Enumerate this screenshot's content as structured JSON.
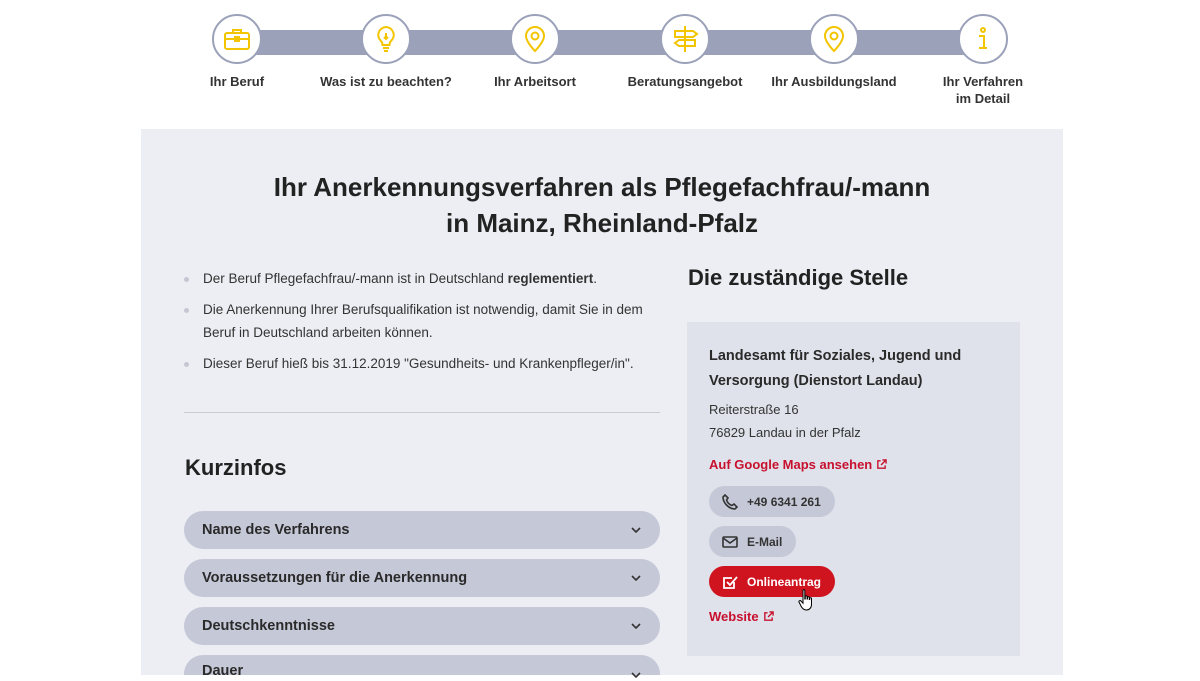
{
  "steps": [
    {
      "label": "Ihr Beruf",
      "icon": "briefcase-icon"
    },
    {
      "label": "Was ist zu beachten?",
      "icon": "lightbulb-icon"
    },
    {
      "label": "Ihr Arbeitsort",
      "icon": "location-pin-icon"
    },
    {
      "label": "Beratungsangebot",
      "icon": "signpost-icon"
    },
    {
      "label": "Ihr Ausbildungsland",
      "icon": "location-pin-icon"
    },
    {
      "label_line1": "Ihr Verfahren",
      "label_line2": "im Detail",
      "icon": "info-icon"
    }
  ],
  "page": {
    "title_line1": "Ihr Anerkennungsverfahren als Pflegefachfrau/-mann",
    "title_line2": "in Mainz, Rheinland-Pfalz"
  },
  "bullets": {
    "b1_pre": "Der Beruf Pflegefachfrau/-mann ist in Deutschland ",
    "b1_bold": "reglementiert",
    "b1_post": ".",
    "b2": "Die Anerkennung Ihrer Berufsqualifikation ist notwendig, damit Sie in dem Beruf in Deutschland arbeiten können.",
    "b3": "Dieser Beruf hieß bis 31.12.2019 \"Gesundheits- und Krankenpfleger/in\"."
  },
  "kurzinfos": {
    "title": "Kurzinfos",
    "items": [
      "Name des Verfahrens",
      "Voraussetzungen für die Anerkennung",
      "Deutschkenntnisse",
      "Dauer"
    ]
  },
  "stelle": {
    "title": "Die zuständige Stelle",
    "org": "Landesamt für Soziales, Jugend und Versorgung (Dienstort Landau)",
    "street": "Reiterstraße 16",
    "city": "76829 Landau in der Pfalz",
    "maps_link": "Auf Google Maps ansehen",
    "phone": "+49 6341 261",
    "email": "E-Mail",
    "online": "Onlineantrag",
    "website": "Website"
  },
  "colors": {
    "accent_yellow": "#f2c500",
    "step_track": "#9aa1b9",
    "panel_bg": "#eceef3",
    "card_bg": "#dfe2ea",
    "pill_bg": "#c5c8d7",
    "brand_red": "#d0141f"
  }
}
